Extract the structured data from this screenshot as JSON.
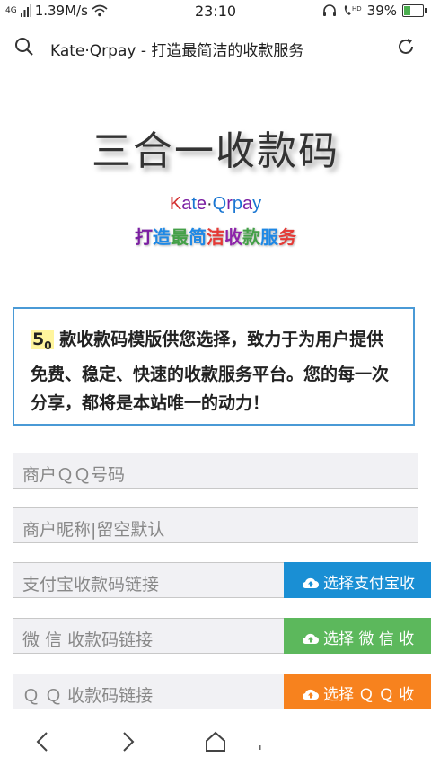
{
  "status": {
    "signal": "4G",
    "speed": "1.39M/s",
    "time": "23:10",
    "battery": "39%",
    "battery_level": 0.39
  },
  "browser": {
    "url_text": "Kate·Qrpay - 打造最简洁的收款服务"
  },
  "hero": {
    "title": "三合一收款码",
    "brand_chars": [
      {
        "t": "K",
        "c": "#d32f2f"
      },
      {
        "t": "a",
        "c": "#7b1fa2"
      },
      {
        "t": "t",
        "c": "#1976d2"
      },
      {
        "t": "e",
        "c": "#7b1fa2"
      },
      {
        "t": "·",
        "c": "#333333"
      },
      {
        "t": "Q",
        "c": "#1976d2"
      },
      {
        "t": "r",
        "c": "#7b1fa2"
      },
      {
        "t": "p",
        "c": "#1976d2"
      },
      {
        "t": "a",
        "c": "#7b1fa2"
      },
      {
        "t": "y",
        "c": "#1976d2"
      }
    ],
    "slogan_chars": [
      {
        "t": "打",
        "c": "#7b1fa2"
      },
      {
        "t": "造",
        "c": "#1e88e5"
      },
      {
        "t": "最",
        "c": "#43a047"
      },
      {
        "t": "简",
        "c": "#1e88e5"
      },
      {
        "t": "洁",
        "c": "#e53935"
      },
      {
        "t": "收",
        "c": "#8e24aa"
      },
      {
        "t": "款",
        "c": "#43a047"
      },
      {
        "t": "服",
        "c": "#1e88e5"
      },
      {
        "t": "务",
        "c": "#e53935"
      }
    ]
  },
  "intro": {
    "count": "5",
    "count_sub": "0",
    "text": " 款收款码模版供您选择，致力于为用户提供免费、稳定、快速的收款服务平台。您的每一次分享，都将是本站唯一的动力！"
  },
  "form": {
    "qq_placeholder": "商户ＱＱ号码",
    "nickname_placeholder": "商户昵称|留空默认",
    "alipay_placeholder": "支付宝收款码链接",
    "wechat_placeholder": " 微 信 收款码链接",
    "qqpay_placeholder": " Ｑ Ｑ 收款码链接",
    "alipay_button": "选择支付宝收",
    "wechat_button": "选择 微 信 收",
    "qq_button": "选择 Ｑ Ｑ 收"
  },
  "colors": {
    "alipay": "#1a8fd4",
    "wechat": "#5cb85c",
    "qq": "#f7821e",
    "intro_border": "#4a9ad6"
  }
}
